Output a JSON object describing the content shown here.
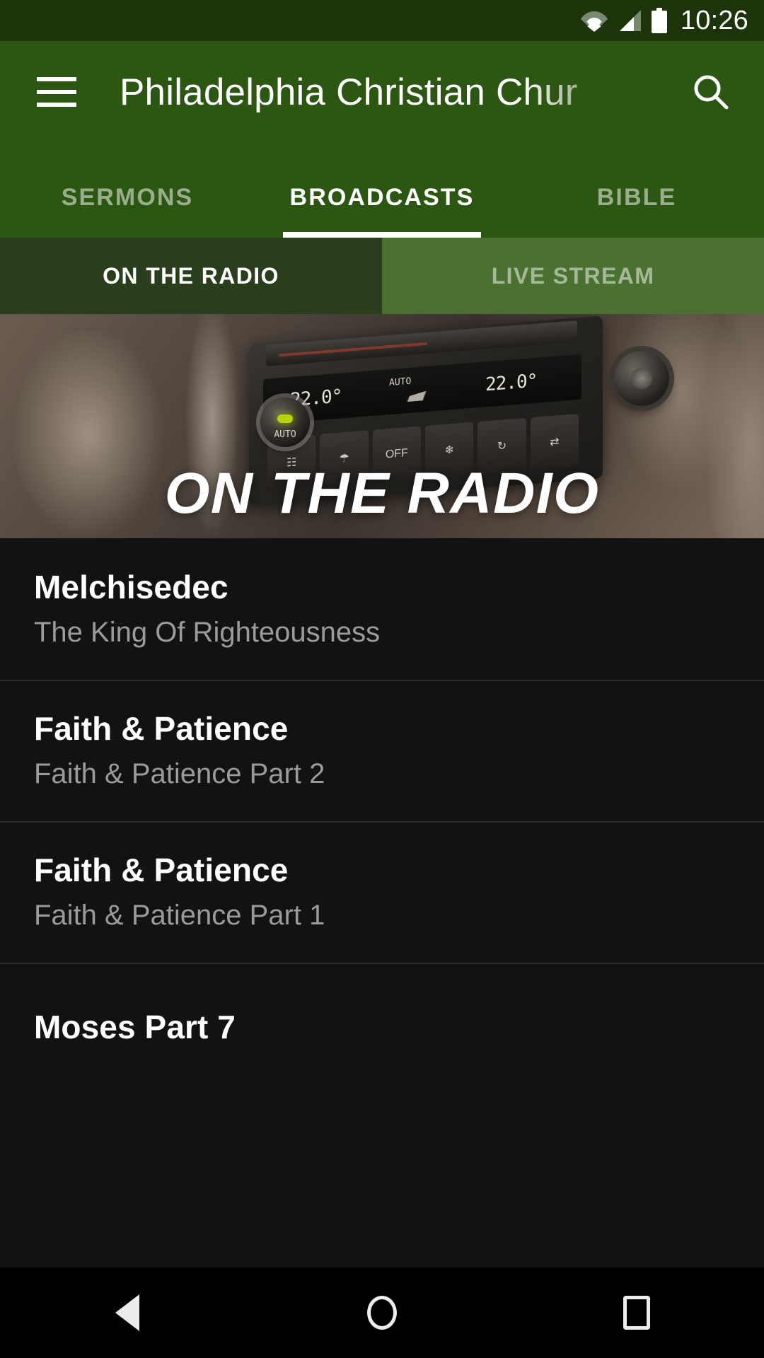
{
  "status_bar": {
    "time": "10:26",
    "icons": [
      "wifi-icon",
      "cellular-signal-icon",
      "battery-icon"
    ],
    "background_color": "#1d3309"
  },
  "app_bar": {
    "menu_icon": "hamburger-menu-icon",
    "title": "Philadelphia Christian Chur",
    "search_icon": "search-icon",
    "background_color": "#2c5712"
  },
  "tabs": {
    "items": [
      {
        "label": "SERMONS",
        "active": false
      },
      {
        "label": "BROADCASTS",
        "active": true
      },
      {
        "label": "BIBLE",
        "active": false
      }
    ],
    "indicator_color": "#ffffff"
  },
  "subtabs": {
    "items": [
      {
        "label": "ON THE RADIO",
        "selected": true,
        "background_color": "#2a3d1c"
      },
      {
        "label": "LIVE STREAM",
        "selected": false,
        "background_color": "#4a7131"
      }
    ]
  },
  "hero": {
    "overlay_title": "ON THE RADIO",
    "image_description": "car-dashboard-climate-control-photo",
    "console": {
      "temp_left": "22.0°",
      "temp_right": "22.0°",
      "auto_label": "AUTO",
      "knob_label": "AUTO",
      "button_labels": [
        "☷",
        "☂",
        "OFF",
        "❄",
        "↻",
        "⇄"
      ]
    }
  },
  "list": {
    "items": [
      {
        "title": "Melchisedec",
        "subtitle": "The King Of Righteousness"
      },
      {
        "title": "Faith & Patience",
        "subtitle": "Faith & Patience Part 2"
      },
      {
        "title": "Faith & Patience",
        "subtitle": "Faith & Patience Part 1"
      },
      {
        "title": "Moses Part 7",
        "subtitle": ""
      }
    ]
  },
  "nav_bar": {
    "buttons": [
      {
        "name": "back-button",
        "icon": "triangle-back-icon"
      },
      {
        "name": "home-button",
        "icon": "circle-home-icon"
      },
      {
        "name": "recents-button",
        "icon": "square-recents-icon"
      }
    ]
  }
}
